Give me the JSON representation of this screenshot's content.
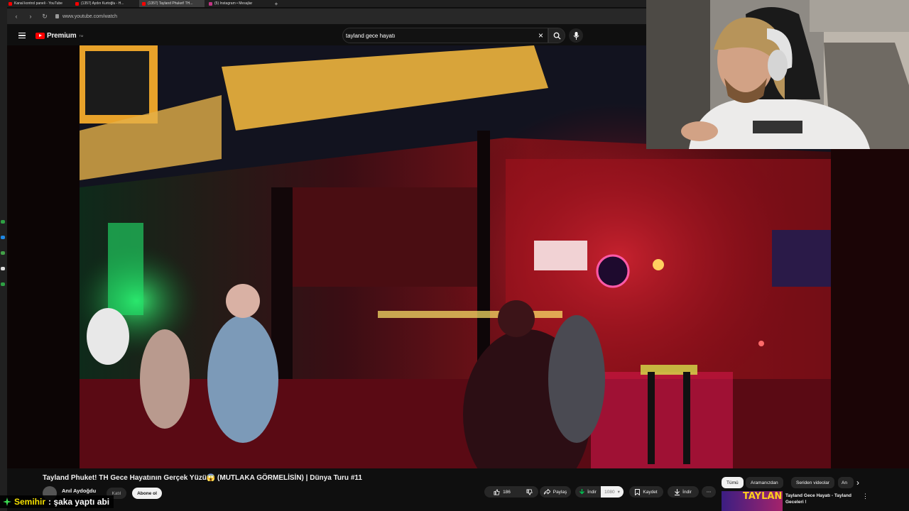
{
  "browser": {
    "tabs": [
      {
        "label": "Kanal kontrol paneli - YouTube",
        "active": false
      },
      {
        "label": "(1357) Aydın Kurtoğlu - H...",
        "active": false
      },
      {
        "label": "(1357) Tayland Phuket! TH...",
        "active": true
      },
      {
        "label": "(5) Instagram • Mesajlar",
        "active": false
      }
    ],
    "new_tab": "+",
    "url": "www.youtube.com/watch"
  },
  "youtube": {
    "logo_text": "Premium",
    "logo_tm": "TM",
    "search_value": "tayland gece hayatı"
  },
  "video": {
    "title": "Tayland Phuket! TH Gece Hayatının Gerçek Yüzü😱 (MUTLAKA GÖRMELİSİN) | Dünya Turu #11",
    "channel": "Anıl Aydoğdu",
    "join_label": "Katıl",
    "subscribe_label": "Abone ol",
    "likes": "186",
    "share_label": "Paylaş",
    "download_label": "İndir",
    "download_quality": "1080",
    "save_label": "Kaydet",
    "download2_label": "İndir",
    "more": "⋯"
  },
  "chips": [
    {
      "label": "Tümü",
      "selected": true
    },
    {
      "label": "Aramanızdan",
      "selected": false
    },
    {
      "label": "Seriden videolar",
      "selected": false
    },
    {
      "label": "An",
      "selected": false
    }
  ],
  "recommendation": {
    "title": "Tayland Gece Hayatı - Tayland Geceleri !",
    "thumb_text": "TAYLAND"
  },
  "chat": {
    "name": "Semihir",
    "message": ": şaka yaptı abi"
  },
  "colors": {
    "yt_red": "#ff0000",
    "chat_name": "#f5e000",
    "download_green": "#00c853"
  }
}
